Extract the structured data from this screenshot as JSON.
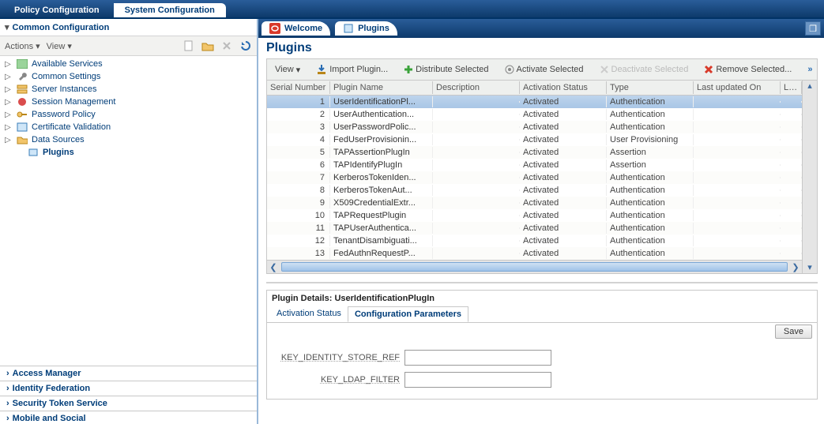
{
  "topTabs": {
    "policy": "Policy Configuration",
    "system": "System Configuration"
  },
  "sidebar": {
    "panelTitle": "Common Configuration",
    "toolbar": {
      "actions": "Actions",
      "view": "View"
    },
    "items": [
      {
        "label": "Available Services"
      },
      {
        "label": "Common Settings"
      },
      {
        "label": "Server Instances"
      },
      {
        "label": "Session Management"
      },
      {
        "label": "Password Policy"
      },
      {
        "label": "Certificate Validation"
      },
      {
        "label": "Data Sources"
      }
    ],
    "childLabel": "Plugins",
    "accordion": [
      "Access Manager",
      "Identity Federation",
      "Security Token Service",
      "Mobile and Social"
    ]
  },
  "contentTabs": {
    "welcome": "Welcome",
    "plugins": "Plugins"
  },
  "pageTitle": "Plugins",
  "gridToolbar": {
    "view": "View",
    "import": "Import Plugin...",
    "distribute": "Distribute Selected",
    "activate": "Activate Selected",
    "deactivate": "Deactivate Selected",
    "remove": "Remove Selected..."
  },
  "columns": {
    "sn": "Serial Number",
    "name": "Plugin Name",
    "desc": "Description",
    "act": "Activation Status",
    "type": "Type",
    "lu1": "Last updated On",
    "lu2": "Last updated"
  },
  "rows": [
    {
      "sn": "1",
      "name": "UserIdentificationPl...",
      "desc": "",
      "act": "Activated",
      "type": "Authentication"
    },
    {
      "sn": "2",
      "name": "UserAuthentication...",
      "desc": "",
      "act": "Activated",
      "type": "Authentication"
    },
    {
      "sn": "3",
      "name": "UserPasswordPolic...",
      "desc": "",
      "act": "Activated",
      "type": "Authentication"
    },
    {
      "sn": "4",
      "name": "FedUserProvisionin...",
      "desc": "",
      "act": "Activated",
      "type": "User Provisioning"
    },
    {
      "sn": "5",
      "name": "TAPAssertionPlugIn",
      "desc": "",
      "act": "Activated",
      "type": "Assertion"
    },
    {
      "sn": "6",
      "name": "TAPIdentifyPlugIn",
      "desc": "",
      "act": "Activated",
      "type": "Assertion"
    },
    {
      "sn": "7",
      "name": "KerberosTokenIden...",
      "desc": "",
      "act": "Activated",
      "type": "Authentication"
    },
    {
      "sn": "8",
      "name": "KerberosTokenAut...",
      "desc": "",
      "act": "Activated",
      "type": "Authentication"
    },
    {
      "sn": "9",
      "name": "X509CredentialExtr...",
      "desc": "",
      "act": "Activated",
      "type": "Authentication"
    },
    {
      "sn": "10",
      "name": "TAPRequestPlugin",
      "desc": "",
      "act": "Activated",
      "type": "Authentication"
    },
    {
      "sn": "11",
      "name": "TAPUserAuthentica...",
      "desc": "",
      "act": "Activated",
      "type": "Authentication"
    },
    {
      "sn": "12",
      "name": "TenantDisambiguati...",
      "desc": "",
      "act": "Activated",
      "type": "Authentication"
    },
    {
      "sn": "13",
      "name": "FedAuthnRequestP...",
      "desc": "",
      "act": "Activated",
      "type": "Authentication"
    }
  ],
  "details": {
    "title": "Plugin Details: UserIdentificationPlugIn",
    "tabs": {
      "activation": "Activation Status",
      "config": "Configuration Parameters"
    },
    "save": "Save",
    "params": [
      {
        "label": "KEY_IDENTITY_STORE_REF",
        "value": ""
      },
      {
        "label": "KEY_LDAP_FILTER",
        "value": ""
      }
    ]
  }
}
